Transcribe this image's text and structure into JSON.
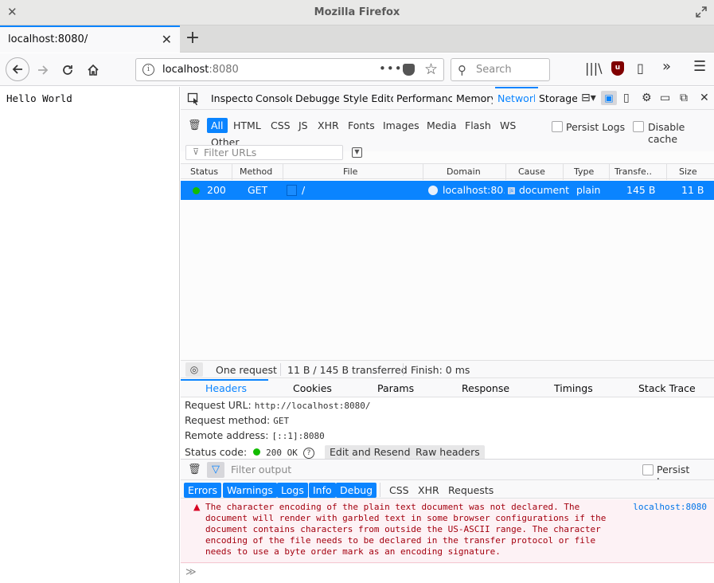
{
  "window": {
    "title": "Mozilla Firefox"
  },
  "tab": {
    "label": "localhost:8080/"
  },
  "urlbar": {
    "host": "localhost",
    "port": ":8080"
  },
  "search": {
    "placeholder": "Search"
  },
  "page": {
    "content": "Hello World"
  },
  "devtools": {
    "tabs": [
      "Inspector",
      "Console",
      "Debugger",
      "Style Editor",
      "Performance",
      "Memory",
      "Network",
      "Storage"
    ],
    "selected_tab": "Network",
    "type_filters": [
      "All",
      "HTML",
      "CSS",
      "JS",
      "XHR",
      "Fonts",
      "Images",
      "Media",
      "Flash",
      "WS",
      "Other"
    ],
    "selected_type": "All",
    "persist_logs": "Persist Logs",
    "disable_cache": "Disable cache",
    "filter_placeholder": "Filter URLs",
    "columns": [
      "Status",
      "Method",
      "File",
      "Domain",
      "Cause",
      "Type",
      "Transfe…",
      "Size"
    ],
    "request": {
      "status": "200",
      "method": "GET",
      "file": "/",
      "domain": "localhost:80…",
      "cause": "document",
      "type": "plain",
      "transferred": "145 B",
      "size": "11 B"
    },
    "summary": {
      "requests": "One request",
      "transferred": "11 B / 145 B transferred",
      "finish": "Finish: 0 ms"
    },
    "side_tabs": [
      "Headers",
      "Cookies",
      "Params",
      "Response",
      "Timings",
      "Stack Trace"
    ],
    "selected_side_tab": "Headers",
    "headers": {
      "request_url_label": "Request URL:",
      "request_url": "http://localhost:8080/",
      "method_label": "Request method:",
      "method": "GET",
      "remote_label": "Remote address:",
      "remote": "[::1]:8080",
      "status_label": "Status code:",
      "status": "200 OK",
      "edit_resend": "Edit and Resend",
      "raw_headers": "Raw headers"
    },
    "console": {
      "filter_placeholder": "Filter output",
      "persist_logs": "Persist Logs",
      "level_filters": [
        "Errors",
        "Warnings",
        "Logs",
        "Info",
        "Debug"
      ],
      "other_filters": [
        "CSS",
        "XHR",
        "Requests"
      ],
      "message": "The character encoding of the plain text document was not declared. The\ndocument will render with garbled text in some browser configurations if the\ndocument contains characters from outside the US-ASCII range. The character\nencoding of the file needs to be declared in the transfer protocol or file\nneeds to use a byte order mark as an encoding signature.",
      "message_source": "localhost:8080",
      "input_prompt": "≫"
    }
  },
  "colors": {
    "accent": "#0a84ff",
    "error_bg": "#fdf2f5",
    "error_text": "#a4000f",
    "status_ok": "#12bc00"
  }
}
